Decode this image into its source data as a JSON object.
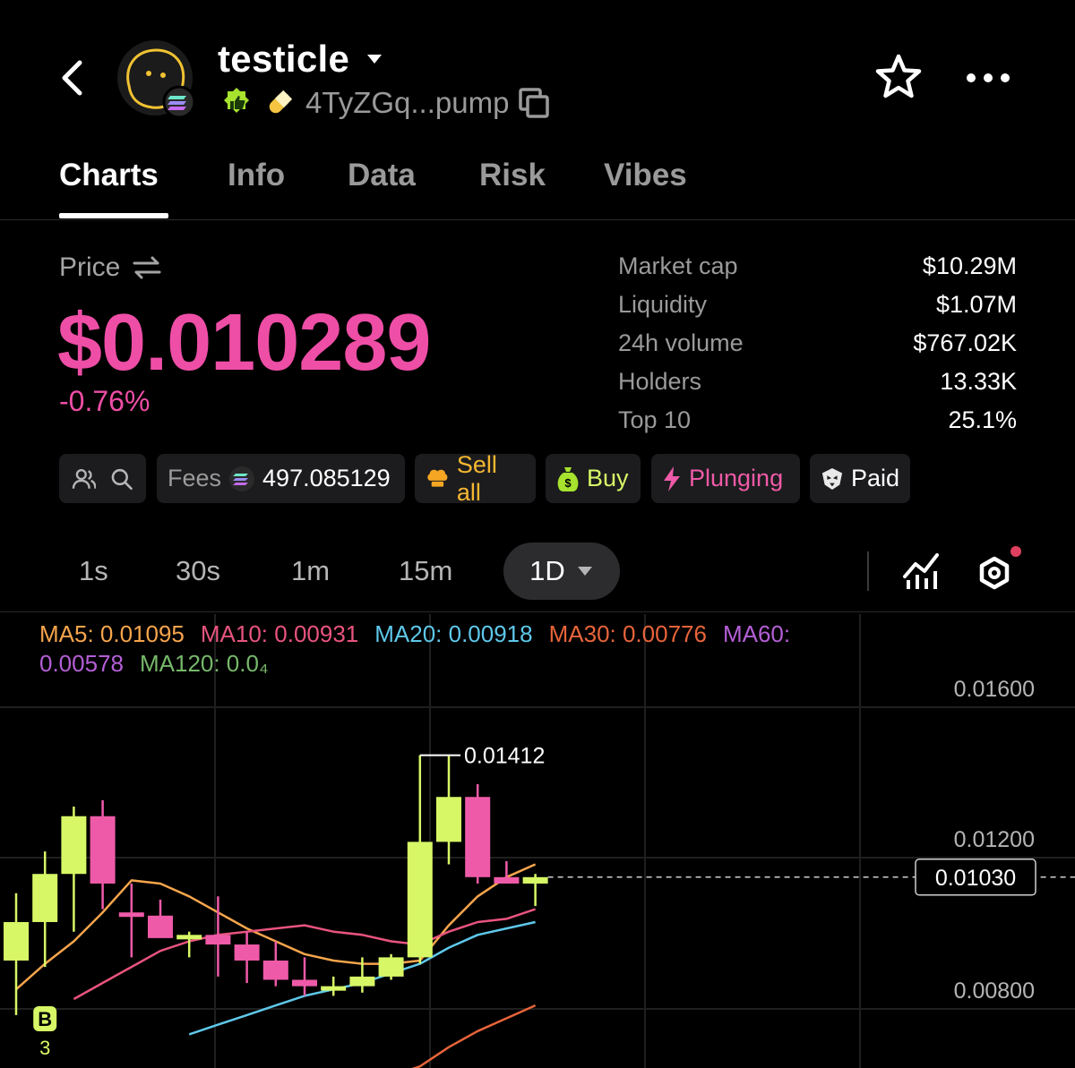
{
  "header": {
    "back_icon": "chevron-left-icon",
    "token_name": "testicle",
    "address": "4TyZGq...pump",
    "colors": {
      "badge_green": "#a6e22e",
      "pill_yellow": "#f5c542"
    }
  },
  "tabs": [
    {
      "label": "Charts",
      "active": true
    },
    {
      "label": "Info"
    },
    {
      "label": "Data"
    },
    {
      "label": "Risk"
    },
    {
      "label": "Vibes"
    }
  ],
  "price": {
    "label": "Price",
    "value": "$0.010289",
    "change": "-0.76%",
    "color": "#ee4ea6"
  },
  "stats": [
    {
      "label": "Market cap",
      "value": "$10.29M"
    },
    {
      "label": "Liquidity",
      "value": "$1.07M"
    },
    {
      "label": "24h volume",
      "value": "$767.02K"
    },
    {
      "label": "Holders",
      "value": "13.33K"
    },
    {
      "label": "Top 10",
      "value": "25.1%"
    }
  ],
  "chips": {
    "fees_label": "Fees",
    "fees_value": "497.085129",
    "sell_all": "Sell all",
    "buy": "Buy",
    "plunging": "Plunging",
    "paid": "Paid"
  },
  "timeframes": {
    "options": [
      "1s",
      "30s",
      "1m",
      "15m"
    ],
    "selected": "1D"
  },
  "ma_legend": [
    {
      "label": "MA5: 0.01095",
      "color": "#f6a54c"
    },
    {
      "label": "MA10: 0.00931",
      "color": "#e9547e"
    },
    {
      "label": "MA20: 0.00918",
      "color": "#5ec8ea"
    },
    {
      "label": "MA30: 0.00776",
      "color": "#e8643a"
    },
    {
      "label": "MA60: 0.00578",
      "color": "#b45fd6"
    },
    {
      "label": "MA120: 0.0₄",
      "color": "#76b86a"
    }
  ],
  "chart_data": {
    "type": "candlestick",
    "y_ticks": [
      "0.01600",
      "0.01200",
      "0.00800"
    ],
    "y_tick_values": [
      0.016,
      0.012,
      0.008
    ],
    "ylim": [
      0.00435,
      0.0185
    ],
    "high_label": "0.01412",
    "current_price_label": "0.01030",
    "current_price": 0.0103,
    "marker_text": "B",
    "marker_count": "3",
    "up_color": "#d7f766",
    "down_color": "#ef5aa8",
    "candles": [
      {
        "o": 0.0077,
        "h": 0.0098,
        "l": 0.006,
        "c": 0.0089
      },
      {
        "o": 0.0089,
        "h": 0.0111,
        "l": 0.0075,
        "c": 0.0104
      },
      {
        "o": 0.0104,
        "h": 0.0125,
        "l": 0.0086,
        "c": 0.0122
      },
      {
        "o": 0.0122,
        "h": 0.0127,
        "l": 0.0093,
        "c": 0.0101
      },
      {
        "o": 0.0092,
        "h": 0.0101,
        "l": 0.0078,
        "c": 0.0091
      },
      {
        "o": 0.0091,
        "h": 0.0096,
        "l": 0.0085,
        "c": 0.0084
      },
      {
        "o": 0.0084,
        "h": 0.0086,
        "l": 0.0078,
        "c": 0.0085
      },
      {
        "o": 0.0085,
        "h": 0.0097,
        "l": 0.0072,
        "c": 0.0082
      },
      {
        "o": 0.0082,
        "h": 0.0086,
        "l": 0.007,
        "c": 0.0077
      },
      {
        "o": 0.0077,
        "h": 0.0083,
        "l": 0.0069,
        "c": 0.0071
      },
      {
        "o": 0.0071,
        "h": 0.0078,
        "l": 0.0066,
        "c": 0.0069
      },
      {
        "o": 0.0069,
        "h": 0.0072,
        "l": 0.0066,
        "c": 0.0069
      },
      {
        "o": 0.0069,
        "h": 0.0078,
        "l": 0.0067,
        "c": 0.0072
      },
      {
        "o": 0.0072,
        "h": 0.0079,
        "l": 0.0071,
        "c": 0.0078
      },
      {
        "o": 0.0078,
        "h": 0.0141,
        "l": 0.0076,
        "c": 0.0114
      },
      {
        "o": 0.0114,
        "h": 0.0141,
        "l": 0.0107,
        "c": 0.0128
      },
      {
        "o": 0.0128,
        "h": 0.0132,
        "l": 0.0101,
        "c": 0.0103
      },
      {
        "o": 0.0103,
        "h": 0.0108,
        "l": 0.0101,
        "c": 0.0101
      },
      {
        "o": 0.0101,
        "h": 0.0104,
        "l": 0.0094,
        "c": 0.0103
      }
    ],
    "ma_lines": [
      {
        "name": "MA5",
        "color": "#f6a54c",
        "values": [
          0.0068,
          0.0076,
          0.0083,
          0.0092,
          0.0102,
          0.0101,
          0.0097,
          0.0092,
          0.0087,
          0.0083,
          0.0079,
          0.0077,
          0.0076,
          0.0076,
          0.0077,
          0.0088,
          0.0097,
          0.0103,
          0.0107
        ]
      },
      {
        "name": "MA10",
        "color": "#e9547e",
        "values": [
          null,
          null,
          0.0065,
          0.007,
          0.0075,
          0.008,
          0.0083,
          0.0085,
          0.0086,
          0.0087,
          0.0088,
          0.0086,
          0.0085,
          0.0083,
          0.0082,
          0.0086,
          0.0089,
          0.009,
          0.0093
        ]
      },
      {
        "name": "MA20",
        "color": "#5ec8ea",
        "values": [
          null,
          null,
          null,
          null,
          null,
          null,
          0.0054,
          0.0057,
          0.006,
          0.0063,
          0.0066,
          0.0068,
          0.007,
          0.0073,
          0.0076,
          0.0081,
          0.0085,
          0.0087,
          0.0089
        ]
      },
      {
        "name": "MA30",
        "color": "#e8643a",
        "values": [
          null,
          null,
          null,
          null,
          null,
          null,
          null,
          null,
          null,
          null,
          null,
          null,
          null,
          0.0041,
          0.0044,
          0.005,
          0.0055,
          0.0059,
          0.0063
        ]
      }
    ]
  }
}
